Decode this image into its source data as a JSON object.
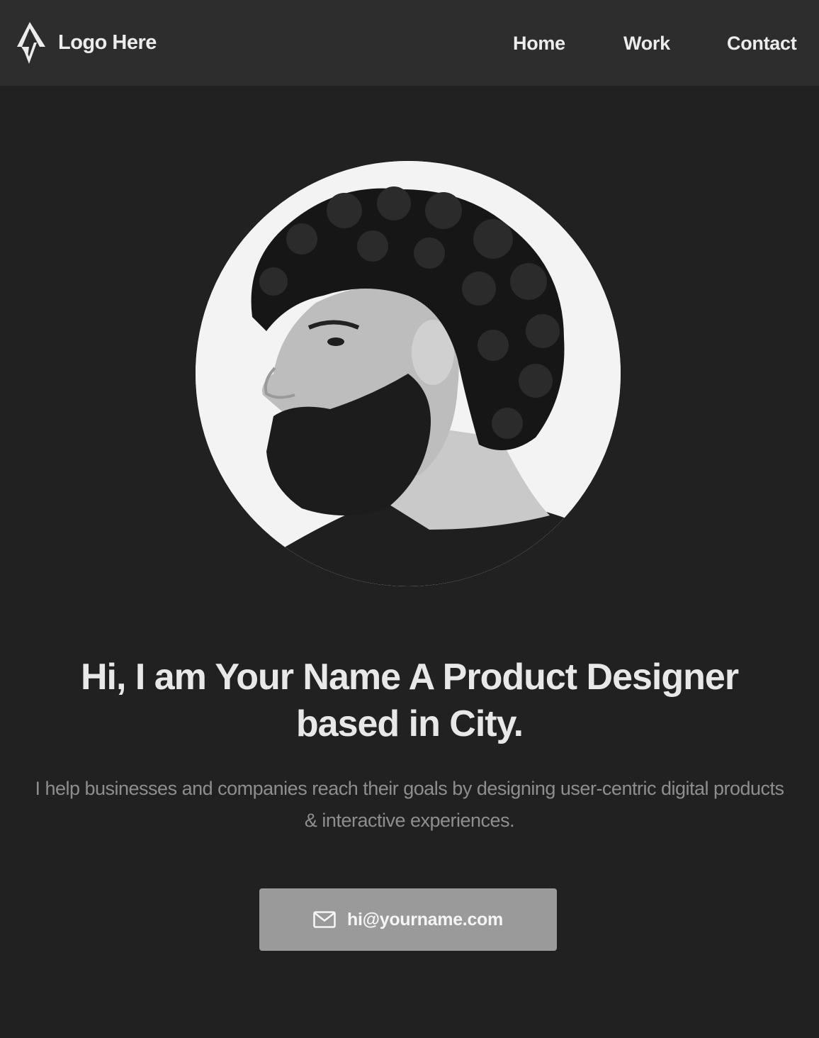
{
  "header": {
    "logo_text": "Logo Here",
    "logo_icon": "zigzag-logo-icon",
    "nav": [
      {
        "label": "Home"
      },
      {
        "label": "Work"
      },
      {
        "label": "Contact"
      }
    ]
  },
  "hero": {
    "headline": "Hi, I am Your Name A Product Designer based in City.",
    "subtext": "I help businesses and companies reach their goals by designing user-centric digital products & interactive experiences.",
    "email_label": "hi@yourname.com",
    "email_icon": "mail-icon"
  },
  "colors": {
    "background": "#212121",
    "navbar": "#2d2d2d",
    "button": "#9a9a9a"
  }
}
